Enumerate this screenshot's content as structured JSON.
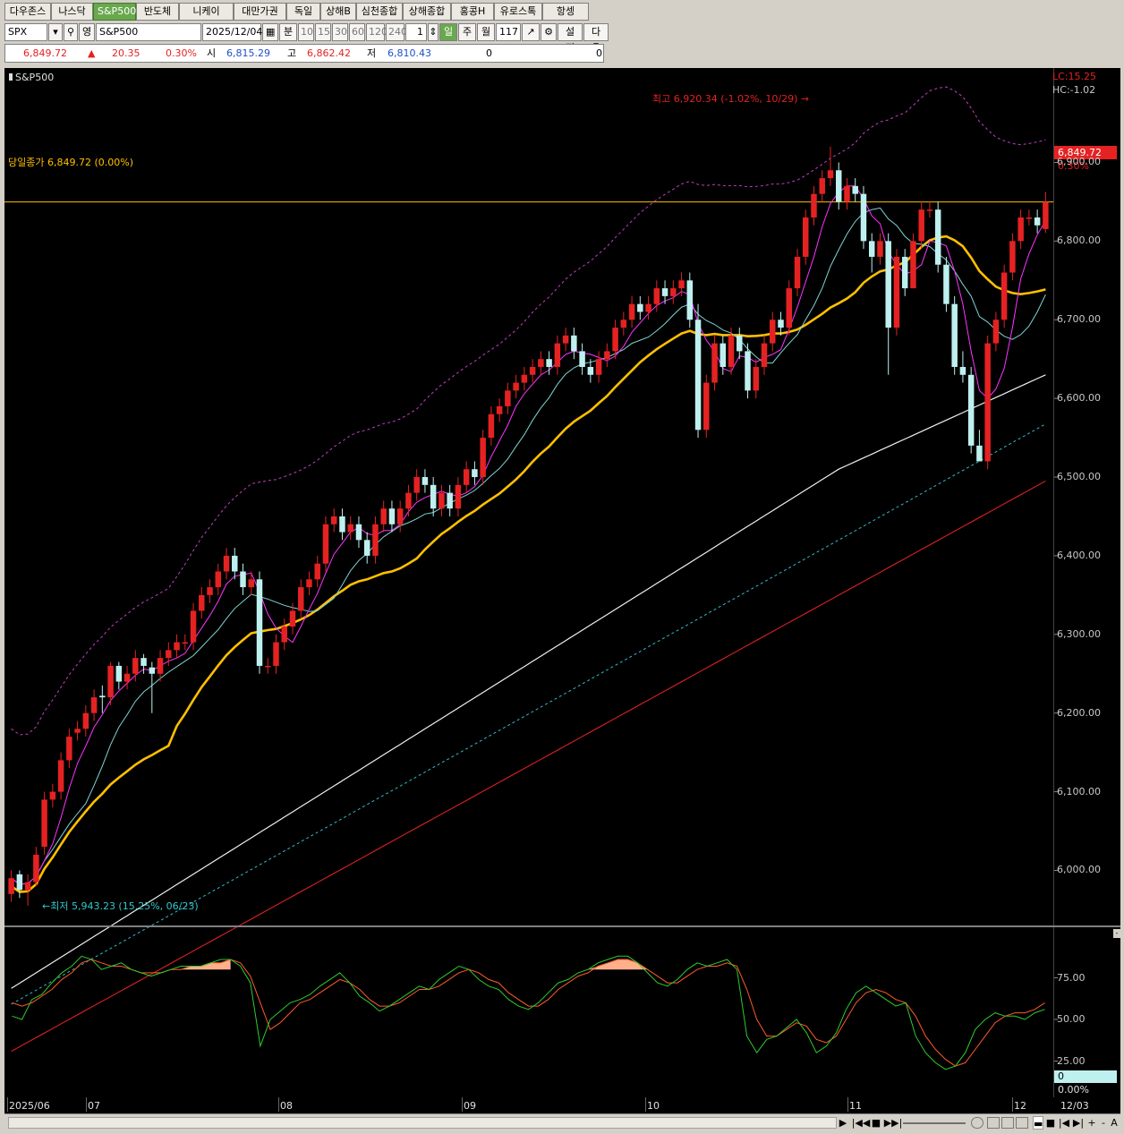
{
  "tabs": [
    "다우존스",
    "나스닥",
    "S&P500",
    "반도체",
    "니케이",
    "대만가권",
    "독일",
    "상해B",
    "심천종합",
    "상해종합",
    "홍콩H",
    "유로스톡",
    "항셍"
  ],
  "active_tab": "S&P500",
  "toolbar": {
    "symbol": "SPX",
    "lock_label": "영",
    "name": "S&P500",
    "date": "2025/12/04",
    "minute_label": "분",
    "periods": [
      "10",
      "15",
      "30",
      "60",
      "120",
      "240"
    ],
    "count": "1",
    "day_label": "일",
    "week_label": "주",
    "month_label": "월",
    "bar_count": "117",
    "settings_label": "설정",
    "next_label": "다음"
  },
  "quote": {
    "price": "6,849.72",
    "arrow": "▲",
    "change": "20.35",
    "change_pct": "0.30%",
    "open_label": "시",
    "open": "6,815.29",
    "high_label": "고",
    "high": "6,862.42",
    "low_label": "저",
    "low": "6,810.43",
    "vol1": "0",
    "vol2": "0"
  },
  "chart_data": {
    "type": "candlestick",
    "title": "S&P500",
    "ylim": [
      5930,
      7020
    ],
    "yticks": [
      "6,900.00",
      "6,800.00",
      "6,700.00",
      "6,600.00",
      "6,500.00",
      "6,400.00",
      "6,300.00",
      "6,200.00",
      "6,100.00",
      "6,000.00"
    ],
    "x_labels": [
      "2025/06",
      "07",
      "08",
      "09",
      "10",
      "11",
      "12"
    ],
    "last_date_label": "12/03",
    "annotations": {
      "high": "최고 6,920.34 (-1.02%, 10/29)",
      "low": "최저 5,943.23 (15.25%, 06/23)",
      "close_line": "당일종가 6,849.72 (0.00%)",
      "lc": "LC:15.25",
      "hc": "HC:-1.02",
      "price_tag": "6,849.72",
      "pct_tag": "0.30%"
    },
    "close": [
      5990,
      5975,
      5985,
      6020,
      6090,
      6100,
      6140,
      6170,
      6180,
      6200,
      6220,
      6220,
      6260,
      6240,
      6250,
      6270,
      6260,
      6250,
      6270,
      6280,
      6290,
      6290,
      6330,
      6350,
      6360,
      6380,
      6400,
      6380,
      6360,
      6370,
      6260,
      6260,
      6290,
      6310,
      6330,
      6360,
      6370,
      6390,
      6440,
      6450,
      6430,
      6440,
      6420,
      6400,
      6440,
      6460,
      6440,
      6460,
      6480,
      6500,
      6490,
      6460,
      6480,
      6460,
      6490,
      6510,
      6500,
      6550,
      6580,
      6590,
      6610,
      6620,
      6630,
      6640,
      6650,
      6640,
      6670,
      6680,
      6660,
      6640,
      6630,
      6650,
      6660,
      6690,
      6700,
      6720,
      6710,
      6720,
      6740,
      6730,
      6740,
      6750,
      6700,
      6560,
      6620,
      6670,
      6640,
      6680,
      6660,
      6610,
      6640,
      6670,
      6700,
      6690,
      6740,
      6780,
      6830,
      6860,
      6880,
      6890,
      6850,
      6870,
      6860,
      6800,
      6780,
      6800,
      6690,
      6780,
      6740,
      6800,
      6840,
      6840,
      6770,
      6720,
      6640,
      6630,
      6540,
      6520,
      6670,
      6700,
      6760,
      6800,
      6830,
      6830,
      6820,
      6849.72
    ],
    "open": [
      5970,
      5995,
      5975,
      5985,
      6030,
      6090,
      6100,
      6140,
      6175,
      6180,
      6200,
      6222,
      6220,
      6260,
      6240,
      6250,
      6270,
      6258,
      6250,
      6270,
      6280,
      6290,
      6290,
      6330,
      6350,
      6360,
      6380,
      6400,
      6380,
      6360,
      6370,
      6260,
      6260,
      6290,
      6310,
      6330,
      6360,
      6370,
      6390,
      6440,
      6450,
      6430,
      6440,
      6420,
      6400,
      6440,
      6460,
      6440,
      6460,
      6480,
      6500,
      6490,
      6460,
      6480,
      6460,
      6490,
      6510,
      6500,
      6550,
      6580,
      6590,
      6610,
      6620,
      6630,
      6640,
      6650,
      6640,
      6670,
      6680,
      6660,
      6640,
      6630,
      6650,
      6660,
      6690,
      6700,
      6720,
      6710,
      6720,
      6740,
      6730,
      6740,
      6750,
      6700,
      6560,
      6620,
      6670,
      6640,
      6680,
      6660,
      6610,
      6640,
      6670,
      6700,
      6690,
      6740,
      6780,
      6830,
      6860,
      6880,
      6890,
      6850,
      6870,
      6860,
      6800,
      6780,
      6800,
      6690,
      6780,
      6740,
      6800,
      6840,
      6840,
      6770,
      6720,
      6640,
      6630,
      6540,
      6520,
      6670,
      6700,
      6760,
      6800,
      6830,
      6830,
      6815.29
    ],
    "high": [
      6000,
      6000,
      5995,
      6030,
      6100,
      6110,
      6150,
      6180,
      6190,
      6210,
      6230,
      6235,
      6265,
      6265,
      6260,
      6280,
      6275,
      6265,
      6280,
      6290,
      6300,
      6300,
      6340,
      6360,
      6370,
      6390,
      6410,
      6410,
      6390,
      6380,
      6380,
      6270,
      6300,
      6320,
      6340,
      6370,
      6380,
      6400,
      6450,
      6460,
      6460,
      6450,
      6450,
      6430,
      6450,
      6470,
      6470,
      6470,
      6490,
      6510,
      6510,
      6500,
      6490,
      6490,
      6500,
      6520,
      6520,
      6560,
      6590,
      6600,
      6620,
      6630,
      6640,
      6650,
      6660,
      6660,
      6680,
      6690,
      6690,
      6670,
      6650,
      6660,
      6670,
      6700,
      6710,
      6730,
      6730,
      6730,
      6750,
      6750,
      6750,
      6760,
      6760,
      6720,
      6630,
      6680,
      6680,
      6690,
      6690,
      6670,
      6650,
      6680,
      6710,
      6710,
      6750,
      6790,
      6840,
      6870,
      6890,
      6920,
      6900,
      6880,
      6880,
      6870,
      6810,
      6810,
      6810,
      6790,
      6790,
      6810,
      6850,
      6850,
      6850,
      6780,
      6730,
      6660,
      6640,
      6560,
      6680,
      6710,
      6770,
      6810,
      6840,
      6840,
      6840,
      6862.42
    ],
    "low": [
      5960,
      5965,
      5955,
      5980,
      6020,
      6080,
      6090,
      6130,
      6165,
      6170,
      6190,
      6200,
      6210,
      6230,
      6230,
      6240,
      6250,
      6200,
      6240,
      6260,
      6270,
      6280,
      6280,
      6320,
      6340,
      6350,
      6370,
      6370,
      6350,
      6350,
      6250,
      6250,
      6250,
      6280,
      6300,
      6320,
      6350,
      6360,
      6380,
      6430,
      6420,
      6420,
      6410,
      6390,
      6390,
      6430,
      6430,
      6430,
      6450,
      6470,
      6480,
      6450,
      6450,
      6450,
      6450,
      6480,
      6490,
      6490,
      6540,
      6570,
      6580,
      6600,
      6610,
      6620,
      6630,
      6630,
      6630,
      6660,
      6650,
      6630,
      6620,
      6620,
      6640,
      6650,
      6680,
      6690,
      6700,
      6700,
      6710,
      6720,
      6720,
      6730,
      6690,
      6550,
      6550,
      6610,
      6630,
      6630,
      6650,
      6600,
      6600,
      6630,
      6660,
      6680,
      6680,
      6730,
      6770,
      6820,
      6850,
      6870,
      6840,
      6840,
      6850,
      6790,
      6760,
      6770,
      6630,
      6680,
      6730,
      6740,
      6790,
      6830,
      6760,
      6710,
      6630,
      6620,
      6530,
      6520,
      6510,
      6660,
      6690,
      6750,
      6790,
      6820,
      6810,
      6810.43
    ],
    "ma5_color": "#ff33ff",
    "ma10_color": "#7fd3d3",
    "ma20_color": "#ffc000",
    "ma60_color": "#f0f0f0",
    "ma120_color": "#cc1f1f",
    "envelope_color": "#c040c0",
    "lower_band_color": "#33bbcc",
    "up_color": "#e52222",
    "down_color": "#bff0f0"
  },
  "stochastic": {
    "yticks": [
      "75.00",
      "50.00",
      "25.00"
    ],
    "value_tag": "0",
    "pct_tag": "0.00%",
    "k": [
      52,
      50,
      62,
      65,
      72,
      78,
      82,
      88,
      86,
      80,
      82,
      84,
      80,
      78,
      76,
      78,
      80,
      82,
      82,
      82,
      84,
      86,
      86,
      82,
      72,
      34,
      50,
      55,
      60,
      62,
      65,
      70,
      74,
      78,
      72,
      64,
      60,
      55,
      58,
      62,
      66,
      70,
      68,
      74,
      78,
      82,
      80,
      74,
      70,
      68,
      62,
      58,
      56,
      60,
      66,
      72,
      74,
      78,
      80,
      84,
      86,
      88,
      88,
      84,
      78,
      72,
      70,
      74,
      80,
      84,
      82,
      84,
      86,
      80,
      40,
      30,
      38,
      40,
      45,
      50,
      42,
      30,
      34,
      42,
      56,
      66,
      70,
      66,
      62,
      58,
      60,
      40,
      30,
      24,
      20,
      22,
      30,
      44,
      50,
      54,
      52,
      52,
      50,
      54,
      56
    ],
    "d": [
      60,
      58,
      60,
      64,
      68,
      74,
      78,
      84,
      86,
      84,
      82,
      82,
      80,
      78,
      78,
      78,
      80,
      80,
      82,
      82,
      84,
      84,
      86,
      84,
      76,
      60,
      44,
      48,
      54,
      60,
      62,
      66,
      70,
      74,
      72,
      68,
      62,
      58,
      58,
      60,
      64,
      68,
      68,
      70,
      74,
      78,
      80,
      78,
      74,
      72,
      66,
      62,
      58,
      58,
      62,
      68,
      72,
      76,
      78,
      82,
      84,
      86,
      86,
      84,
      80,
      76,
      72,
      72,
      76,
      80,
      82,
      82,
      84,
      82,
      68,
      50,
      40,
      40,
      44,
      48,
      46,
      38,
      36,
      40,
      50,
      60,
      66,
      68,
      66,
      62,
      60,
      52,
      40,
      32,
      26,
      22,
      24,
      32,
      40,
      48,
      52,
      54,
      54,
      56,
      60
    ]
  },
  "scrollbar": {
    "buttons": [
      "◀",
      "▶",
      "|◀◀",
      "■",
      "▶▶|",
      "+",
      "-",
      "A"
    ]
  }
}
